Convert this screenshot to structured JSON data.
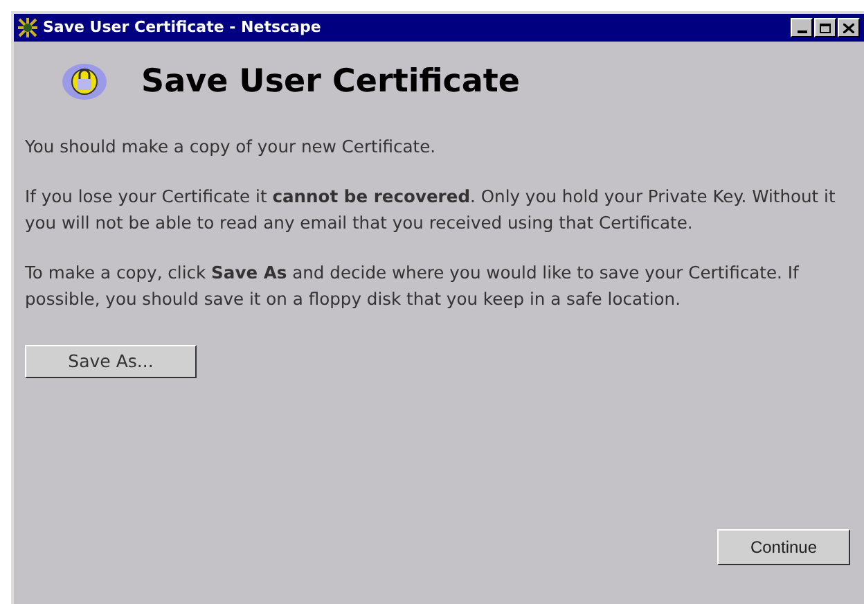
{
  "window": {
    "title": "Save User Certificate - Netscape"
  },
  "heading": "Save User Certificate",
  "paragraphs": [
    "You should make a copy of your new Certificate.",
    "If you lose your Certificate it **cannot be recovered**. Only you hold your Private Key. Without it you will not be able to read any email that you received using that Certificate.",
    "To make a copy, click **Save As** and decide where you would like to save your Certificate. If possible, you should save it on a floppy disk that you keep in a safe location."
  ],
  "save_button": "Save As...",
  "continue_button": "Continue"
}
